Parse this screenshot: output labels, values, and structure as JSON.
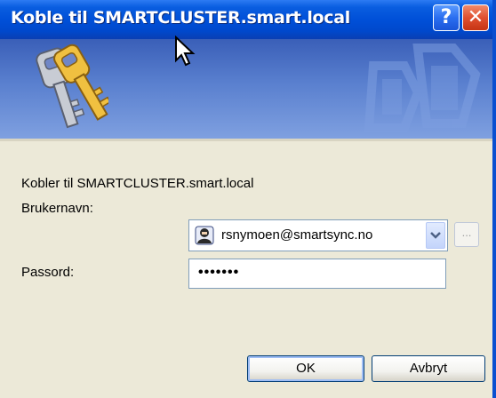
{
  "window": {
    "title": "Koble til SMARTCLUSTER.smart.local",
    "help_label": "?",
    "close_label": "✕"
  },
  "banner": {
    "icon": "keys-icon"
  },
  "body": {
    "connect_text": "Kobler til SMARTCLUSTER.smart.local",
    "username_label": "Brukernavn:",
    "username_value": "rsnymoen@smartsync.no",
    "user_icon": "user-icon",
    "browse_label": "...",
    "password_label": "Passord:",
    "password_value": "•••••••"
  },
  "buttons": {
    "ok_label": "OK",
    "cancel_label": "Avbryt"
  },
  "colors": {
    "titlebar": "#0050d8",
    "dialog_bg": "#ece9d8",
    "close": "#e05030"
  }
}
